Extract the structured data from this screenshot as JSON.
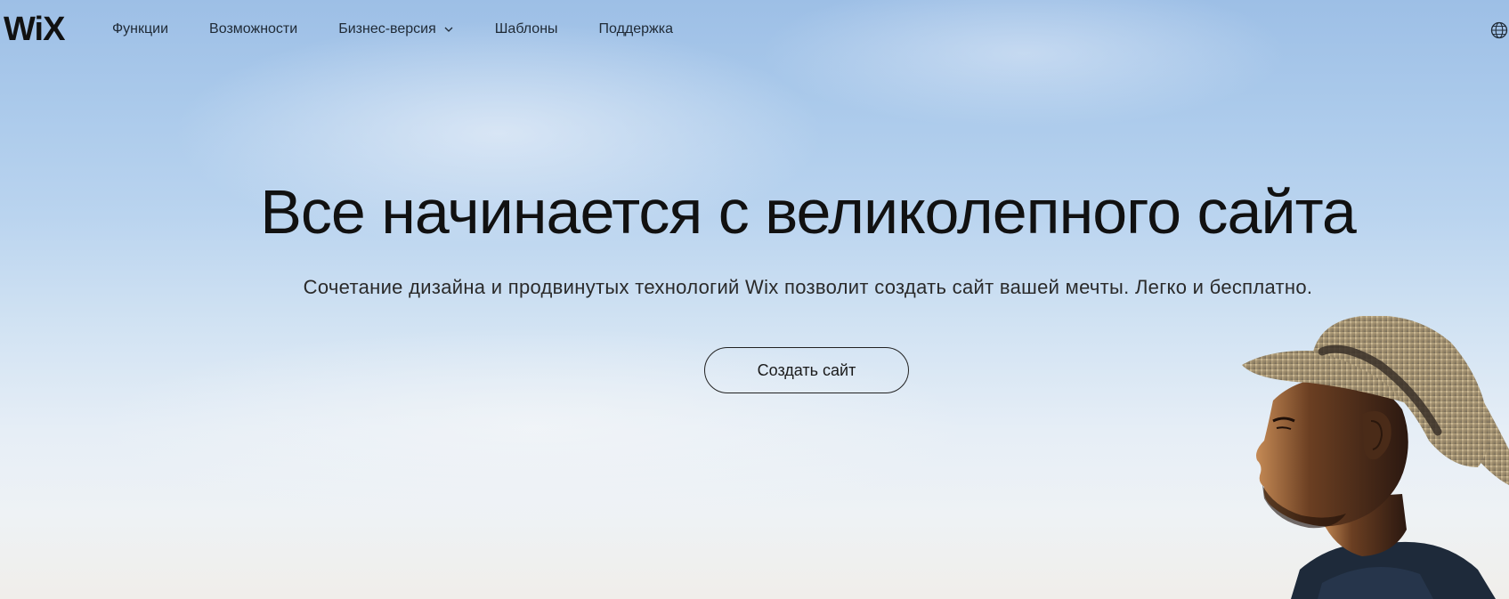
{
  "header": {
    "logo_text": "WiX",
    "nav": [
      {
        "label": "Функции",
        "has_dropdown": false
      },
      {
        "label": "Возможности",
        "has_dropdown": false
      },
      {
        "label": "Бизнес-версия",
        "has_dropdown": true
      },
      {
        "label": "Шаблоны",
        "has_dropdown": false
      },
      {
        "label": "Поддержка",
        "has_dropdown": false
      }
    ],
    "language_icon": "globe-icon"
  },
  "hero": {
    "title": "Все начинается с великолепного сайта",
    "subtitle": "Сочетание дизайна и продвинутых технологий Wix позволит создать сайт вашей мечты. Легко и бесплатно.",
    "cta_label": "Создать сайт",
    "image": "man-in-straw-hat-photo"
  },
  "colors": {
    "sky_top": "#9dbfe6",
    "sky_bottom": "#f0eeea",
    "text": "#111111"
  }
}
